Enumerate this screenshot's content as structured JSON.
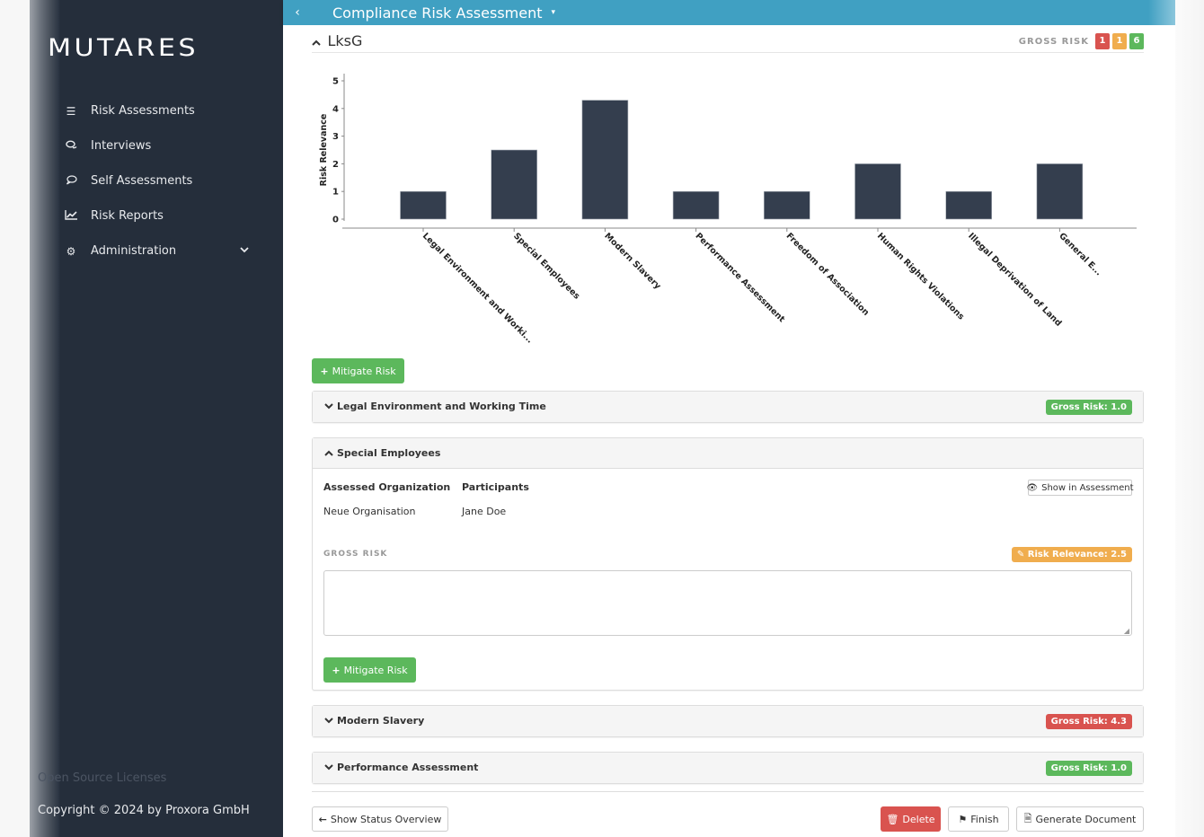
{
  "sidebar": {
    "logo": "MUTARES",
    "items": [
      {
        "label": "Risk Assessments",
        "icon": "list-icon",
        "glyph": "☰"
      },
      {
        "label": "Interviews",
        "icon": "comments-icon",
        "glyph": "🗨"
      },
      {
        "label": "Self Assessments",
        "icon": "comment-icon",
        "glyph": "◌"
      },
      {
        "label": "Risk Reports",
        "icon": "line-chart-icon",
        "glyph": "📈"
      },
      {
        "label": "Administration",
        "icon": "gears-icon",
        "glyph": "⚙",
        "expandable": true
      }
    ],
    "open_source_licenses": "Open Source Licenses",
    "copyright": "Copyright © 2024 by Proxora GmbH"
  },
  "topbar": {
    "back_glyph": "‹",
    "title": "Compliance Risk Assessment",
    "caret": "▾"
  },
  "section": {
    "title": "LksG",
    "gross_risk_label": "GROSS RISK",
    "counts": {
      "high": "1",
      "medium": "1",
      "low": "6"
    },
    "colors": {
      "high": "#d9534f",
      "medium": "#f0ad4e",
      "low": "#5cb85c"
    }
  },
  "chart_data": {
    "type": "bar",
    "title": "",
    "xlabel": "",
    "ylabel": "Risk Relevance",
    "ylim": [
      0,
      5
    ],
    "yticks": [
      "0",
      "1",
      "2",
      "3",
      "4",
      "5"
    ],
    "categories": [
      "Legal Environment and Worki...",
      "Special Employees",
      "Modern Slavery",
      "Performance Assessment",
      "Freedom of Association",
      "Human Rights Violations",
      "Illegal Deprivation of Land",
      "General E..."
    ],
    "values": [
      1.0,
      2.5,
      4.3,
      1.0,
      1.0,
      2.0,
      1.0,
      2.0
    ],
    "bar_color": "#343e4e",
    "grid": false
  },
  "buttons": {
    "mitigate_risk": "Mitigate Risk",
    "show_status_overview": "Show Status Overview",
    "delete": "Delete",
    "finish": "Finish",
    "generate_document": "Generate Document",
    "show_in_assessment": "Show in Assessment"
  },
  "panels": [
    {
      "title": "Legal Environment and Working Time",
      "badge": "Gross Risk: 1.0",
      "badge_color": "#5cb85c",
      "expanded": false
    },
    {
      "title": "Special Employees",
      "expanded": true,
      "assessed_org_label": "Assessed Organization",
      "assessed_org_value": "Neue Organisation",
      "participants_label": "Participants",
      "participants_value": "Jane Doe",
      "gross_risk_label": "GROSS RISK",
      "risk_relevance_badge": "Risk Relevance: 2.5",
      "badge_color": "#f0ad4e",
      "textarea_value": ""
    },
    {
      "title": "Modern Slavery",
      "badge": "Gross Risk: 4.3",
      "badge_color": "#d9534f",
      "expanded": false
    },
    {
      "title": "Performance Assessment",
      "badge": "Gross Risk: 1.0",
      "badge_color": "#5cb85c",
      "expanded": false
    }
  ]
}
